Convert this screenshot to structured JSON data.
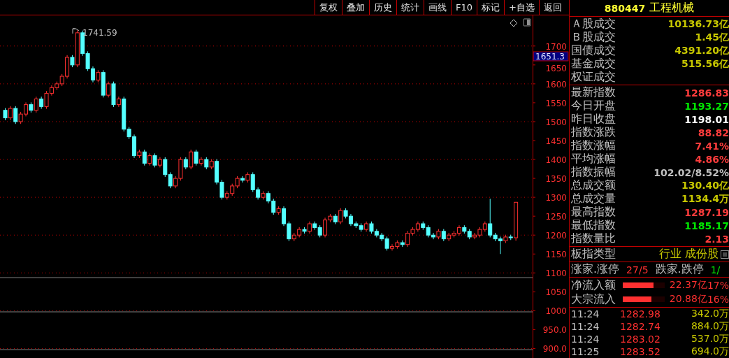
{
  "toolbar": [
    "复权",
    "叠加",
    "历史",
    "统计",
    "画线",
    "F10",
    "标记",
    "+自选",
    "返回"
  ],
  "chart": {
    "peak_label": "1741.59",
    "current_price": "1651.3",
    "chart_data": {
      "type": "candlestick",
      "grid": true,
      "ylim": [
        875,
        1781
      ],
      "yticks": [
        1700,
        1650,
        1600,
        1550,
        1500,
        1450,
        1400,
        1350,
        1300,
        1250,
        1200,
        1150,
        1100,
        1050,
        1000,
        {
          "value": 950,
          "label": "950.0"
        },
        {
          "value": 900,
          "label": "900.0"
        }
      ],
      "ohlc": [
        [
          1530,
          1536,
          1504,
          1510
        ],
        [
          1510,
          1541,
          1504,
          1535
        ],
        [
          1535,
          1541,
          1494,
          1500
        ],
        [
          1500,
          1526,
          1494,
          1520
        ],
        [
          1520,
          1551,
          1514,
          1545
        ],
        [
          1545,
          1551,
          1524,
          1530
        ],
        [
          1530,
          1566,
          1524,
          1560
        ],
        [
          1560,
          1566,
          1534,
          1540
        ],
        [
          1540,
          1581,
          1534,
          1575
        ],
        [
          1575,
          1596,
          1569,
          1590
        ],
        [
          1590,
          1606,
          1584,
          1600
        ],
        [
          1600,
          1626,
          1594,
          1620
        ],
        [
          1620,
          1676,
          1614,
          1670
        ],
        [
          1670,
          1676,
          1644,
          1650
        ],
        [
          1650,
          1741.59,
          1644,
          1735
        ],
        [
          1735,
          1741,
          1674,
          1680
        ],
        [
          1680,
          1686,
          1634,
          1640
        ],
        [
          1640,
          1646,
          1604,
          1610
        ],
        [
          1610,
          1636,
          1604,
          1630
        ],
        [
          1630,
          1636,
          1564,
          1570
        ],
        [
          1570,
          1606,
          1564,
          1600
        ],
        [
          1600,
          1606,
          1539,
          1545
        ],
        [
          1545,
          1566,
          1539,
          1560
        ],
        [
          1560,
          1566,
          1474,
          1480
        ],
        [
          1480,
          1486,
          1454,
          1460
        ],
        [
          1460,
          1466,
          1404,
          1410
        ],
        [
          1410,
          1426,
          1404,
          1420
        ],
        [
          1420,
          1426,
          1384,
          1390
        ],
        [
          1390,
          1416,
          1384,
          1410
        ],
        [
          1410,
          1416,
          1379,
          1385
        ],
        [
          1385,
          1406,
          1379,
          1400
        ],
        [
          1400,
          1406,
          1354,
          1360
        ],
        [
          1360,
          1366,
          1324,
          1330
        ],
        [
          1330,
          1356,
          1324,
          1350
        ],
        [
          1350,
          1406,
          1344,
          1400
        ],
        [
          1400,
          1406,
          1374,
          1380
        ],
        [
          1380,
          1426,
          1374,
          1420
        ],
        [
          1420,
          1426,
          1384,
          1390
        ],
        [
          1390,
          1406,
          1384,
          1400
        ],
        [
          1400,
          1406,
          1374,
          1380
        ],
        [
          1380,
          1401,
          1374,
          1395
        ],
        [
          1395,
          1401,
          1334,
          1340
        ],
        [
          1340,
          1346,
          1294,
          1300
        ],
        [
          1300,
          1316,
          1294,
          1310
        ],
        [
          1310,
          1336,
          1304,
          1330
        ],
        [
          1330,
          1356,
          1324,
          1350
        ],
        [
          1350,
          1356,
          1339,
          1345
        ],
        [
          1345,
          1366,
          1339,
          1360
        ],
        [
          1360,
          1366,
          1314,
          1320
        ],
        [
          1320,
          1326,
          1294,
          1300
        ],
        [
          1300,
          1316,
          1294,
          1310
        ],
        [
          1310,
          1316,
          1284,
          1290
        ],
        [
          1290,
          1296,
          1254,
          1260
        ],
        [
          1260,
          1276,
          1254,
          1270
        ],
        [
          1270,
          1276,
          1224,
          1230
        ],
        [
          1230,
          1236,
          1184,
          1190
        ],
        [
          1190,
          1206,
          1184,
          1200
        ],
        [
          1200,
          1221,
          1194,
          1215
        ],
        [
          1215,
          1221,
          1204,
          1210
        ],
        [
          1210,
          1236,
          1204,
          1230
        ],
        [
          1230,
          1236,
          1214,
          1220
        ],
        [
          1220,
          1226,
          1194,
          1200
        ],
        [
          1200,
          1246,
          1194,
          1240
        ],
        [
          1240,
          1256,
          1234,
          1250
        ],
        [
          1250,
          1256,
          1229,
          1235
        ],
        [
          1235,
          1271,
          1229,
          1265
        ],
        [
          1265,
          1271,
          1244,
          1250
        ],
        [
          1250,
          1256,
          1224,
          1230
        ],
        [
          1230,
          1236,
          1219,
          1225
        ],
        [
          1225,
          1231,
          1209,
          1215
        ],
        [
          1215,
          1236,
          1209,
          1230
        ],
        [
          1230,
          1236,
          1204,
          1210
        ],
        [
          1210,
          1216,
          1194,
          1200
        ],
        [
          1200,
          1206,
          1184,
          1190
        ],
        [
          1190,
          1196,
          1159,
          1165
        ],
        [
          1165,
          1176,
          1159,
          1170
        ],
        [
          1170,
          1186,
          1164,
          1180
        ],
        [
          1180,
          1186,
          1169,
          1175
        ],
        [
          1175,
          1211,
          1169,
          1205
        ],
        [
          1205,
          1221,
          1199,
          1215
        ],
        [
          1215,
          1236,
          1209,
          1230
        ],
        [
          1230,
          1236,
          1214,
          1220
        ],
        [
          1220,
          1226,
          1194,
          1200
        ],
        [
          1200,
          1206,
          1189,
          1195
        ],
        [
          1195,
          1216,
          1189,
          1210
        ],
        [
          1210,
          1216,
          1184,
          1190
        ],
        [
          1190,
          1206,
          1184,
          1200
        ],
        [
          1200,
          1211,
          1194,
          1205
        ],
        [
          1205,
          1226,
          1199,
          1220
        ],
        [
          1220,
          1226,
          1204,
          1210
        ],
        [
          1210,
          1216,
          1189,
          1195
        ],
        [
          1195,
          1206,
          1189,
          1200
        ],
        [
          1200,
          1221,
          1194,
          1215
        ],
        [
          1215,
          1236,
          1209,
          1230
        ],
        [
          1230,
          1296,
          1194,
          1200
        ],
        [
          1200,
          1206,
          1184,
          1190
        ],
        [
          1190,
          1196,
          1150,
          1185
        ],
        [
          1185,
          1201,
          1179,
          1195
        ],
        [
          1195,
          1201,
          1187,
          1193
        ],
        [
          1193,
          1287.19,
          1185.17,
          1286.83
        ]
      ]
    }
  },
  "panel": {
    "code": "880447",
    "name": "工程机械",
    "turnover": [
      {
        "label": "Ａ股成交",
        "value": "10136.73亿",
        "color": "#c8c800"
      },
      {
        "label": "Ｂ股成交",
        "value": "1.45亿",
        "color": "#c8c800"
      },
      {
        "label": "国债成交",
        "value": "4391.20亿",
        "color": "#c8c800"
      },
      {
        "label": "基金成交",
        "value": "515.56亿",
        "color": "#c8c800"
      },
      {
        "label": "权证成交"
      }
    ],
    "stats": [
      {
        "label": "最新指数",
        "value": "1286.83",
        "color": "#ff3c3c"
      },
      {
        "label": "今日开盘",
        "value": "1193.27",
        "color": "#00e600"
      },
      {
        "label": "昨日收盘",
        "value": "1198.01",
        "color": "#ffffff"
      },
      {
        "label": "指数涨跌",
        "value": "88.82",
        "color": "#ff3c3c"
      },
      {
        "label": "指数涨幅",
        "value": "7.41%",
        "color": "#ff3c3c"
      },
      {
        "label": "平均涨幅",
        "value": "4.86%",
        "color": "#ff3c3c"
      },
      {
        "label": "指数振幅",
        "value": "102.02/8.52%",
        "color": "#c0c0c0"
      },
      {
        "label": "总成交额",
        "value": "130.40亿",
        "color": "#c8c800"
      },
      {
        "label": "总成交量",
        "value": "1134.4万",
        "color": "#c8c800"
      },
      {
        "label": "最高指数",
        "value": "1287.19",
        "color": "#ff3c3c"
      },
      {
        "label": "最低指数",
        "value": "1185.17",
        "color": "#00e600"
      },
      {
        "label": "指数量比",
        "value": "2.13",
        "color": "#ff3c3c"
      }
    ],
    "board_type": {
      "label": "板指类型",
      "value": "行业 成份股"
    },
    "breadth": {
      "up_label": "涨家.涨停",
      "up_value": "27/5",
      "down_label": "跌家.跌停",
      "down_value": "1/"
    },
    "flows": [
      {
        "label": "净流入额",
        "level": 0.74,
        "amount": "22.37亿",
        "percent": "17%"
      },
      {
        "label": "大宗流入",
        "level": 0.69,
        "amount": "20.88亿",
        "percent": "16%"
      }
    ],
    "trades": [
      {
        "time": "11:24",
        "price": "1282.98",
        "volume": "342.0万"
      },
      {
        "time": "11:24",
        "price": "1282.74",
        "volume": "884.0万"
      },
      {
        "time": "11:24",
        "price": "1283.02",
        "volume": "537.0万"
      },
      {
        "time": "11:25",
        "price": "1283.52",
        "volume": "694.0万"
      }
    ]
  }
}
